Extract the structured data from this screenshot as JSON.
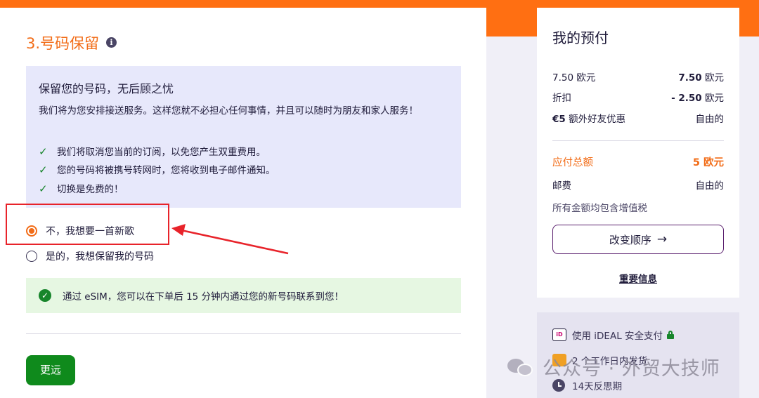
{
  "section": {
    "title": "3.号码保留",
    "info_icon_glyph": "i"
  },
  "keep_box": {
    "title": "保留您的号码，无后顾之忧",
    "description": "我们将为您安排接送服务。这样您就不必担心任何事情，并且可以随时为朋友和家人服务！",
    "checks": [
      "我们将取消您当前的订阅，以免您产生双重费用。",
      "您的号码将被携号转网时，您将收到电子邮件通知。",
      "切换是免费的！"
    ]
  },
  "options": [
    {
      "label": "不，我想要一首新歌",
      "selected": true
    },
    {
      "label": "是的，我想保留我的号码",
      "selected": false
    }
  ],
  "esim_notice": {
    "text": "通过 eSIM，您可以在下单后 15 分钟内通过您的新号码联系到您！"
  },
  "next_button": {
    "label": "更远"
  },
  "summary": {
    "title": "我的预付",
    "rows": [
      {
        "label": "7.50 欧元",
        "value": "7.50",
        "unit": "欧元"
      },
      {
        "label": "折扣",
        "value": "- 2.50",
        "unit": "欧元"
      },
      {
        "label": "€5",
        "label_suffix": "额外好友优惠",
        "value_plain": "自由的"
      }
    ],
    "total": {
      "label": "应付总额",
      "value": "5",
      "unit": "欧元"
    },
    "shipping": {
      "label": "邮费",
      "value": "自由的"
    },
    "tax_note": "所有金额均包含增值税",
    "change_button": "改变顺序",
    "important_link": "重要信息"
  },
  "perks": {
    "ideal_icon_text": "iD",
    "ideal": "使用 iDEAL 安全支付",
    "shipping": "2 个工作日内发货",
    "reflection": "14天反思期"
  },
  "watermark": {
    "text": "公众号 · 外贸大技师"
  },
  "colors": {
    "brand_orange": "#ff6f12",
    "accent_orange": "#f26c17",
    "green": "#0f8a1c",
    "annotation_red": "#e8232a"
  }
}
